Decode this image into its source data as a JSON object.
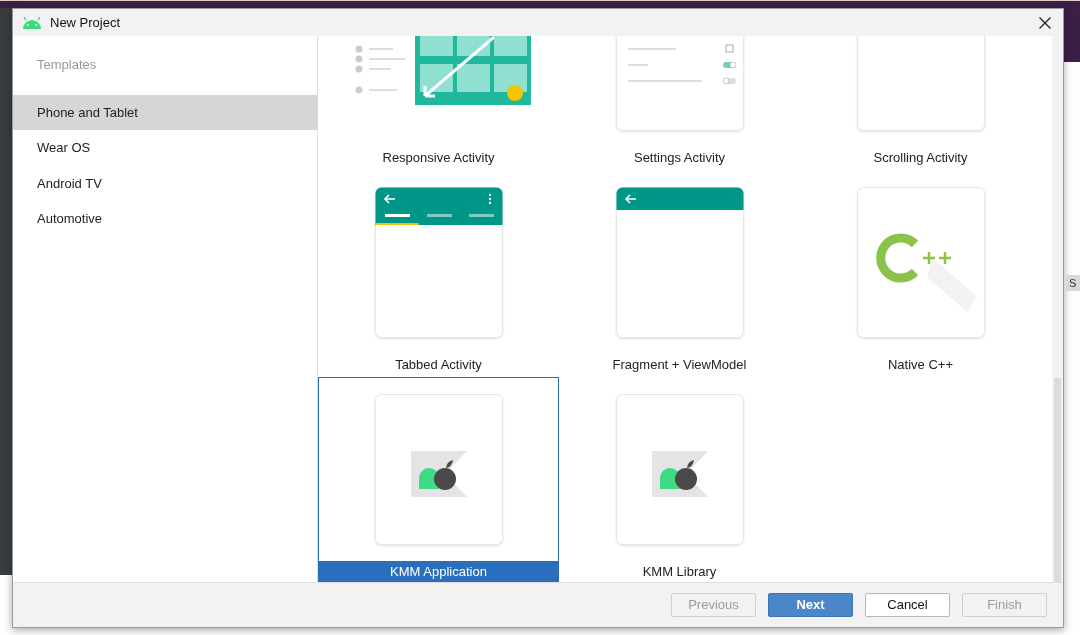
{
  "window": {
    "title": "New Project"
  },
  "sidebar": {
    "heading": "Templates",
    "items": [
      {
        "label": "Phone and Tablet",
        "selected": true
      },
      {
        "label": "Wear OS",
        "selected": false
      },
      {
        "label": "Android TV",
        "selected": false
      },
      {
        "label": "Automotive",
        "selected": false
      }
    ]
  },
  "templates": [
    {
      "label": "Responsive Activity",
      "kind": "responsive",
      "selected": false
    },
    {
      "label": "Settings Activity",
      "kind": "settings",
      "selected": false
    },
    {
      "label": "Scrolling Activity",
      "kind": "blank",
      "selected": false
    },
    {
      "label": "Tabbed Activity",
      "kind": "tabbed",
      "selected": false
    },
    {
      "label": "Fragment + ViewModel",
      "kind": "fragment",
      "selected": false
    },
    {
      "label": "Native C++",
      "kind": "cpp",
      "selected": false
    },
    {
      "label": "KMM Application",
      "kind": "kmm",
      "selected": true
    },
    {
      "label": "KMM Library",
      "kind": "kmm",
      "selected": false
    }
  ],
  "buttons": [
    {
      "label": "Previous",
      "kind": "secondary",
      "disabled": true
    },
    {
      "label": "Next",
      "kind": "primary",
      "disabled": false
    },
    {
      "label": "Cancel",
      "kind": "secondary",
      "disabled": false
    },
    {
      "label": "Finish",
      "kind": "secondary",
      "disabled": true
    }
  ],
  "background": {
    "fragment": "S"
  }
}
